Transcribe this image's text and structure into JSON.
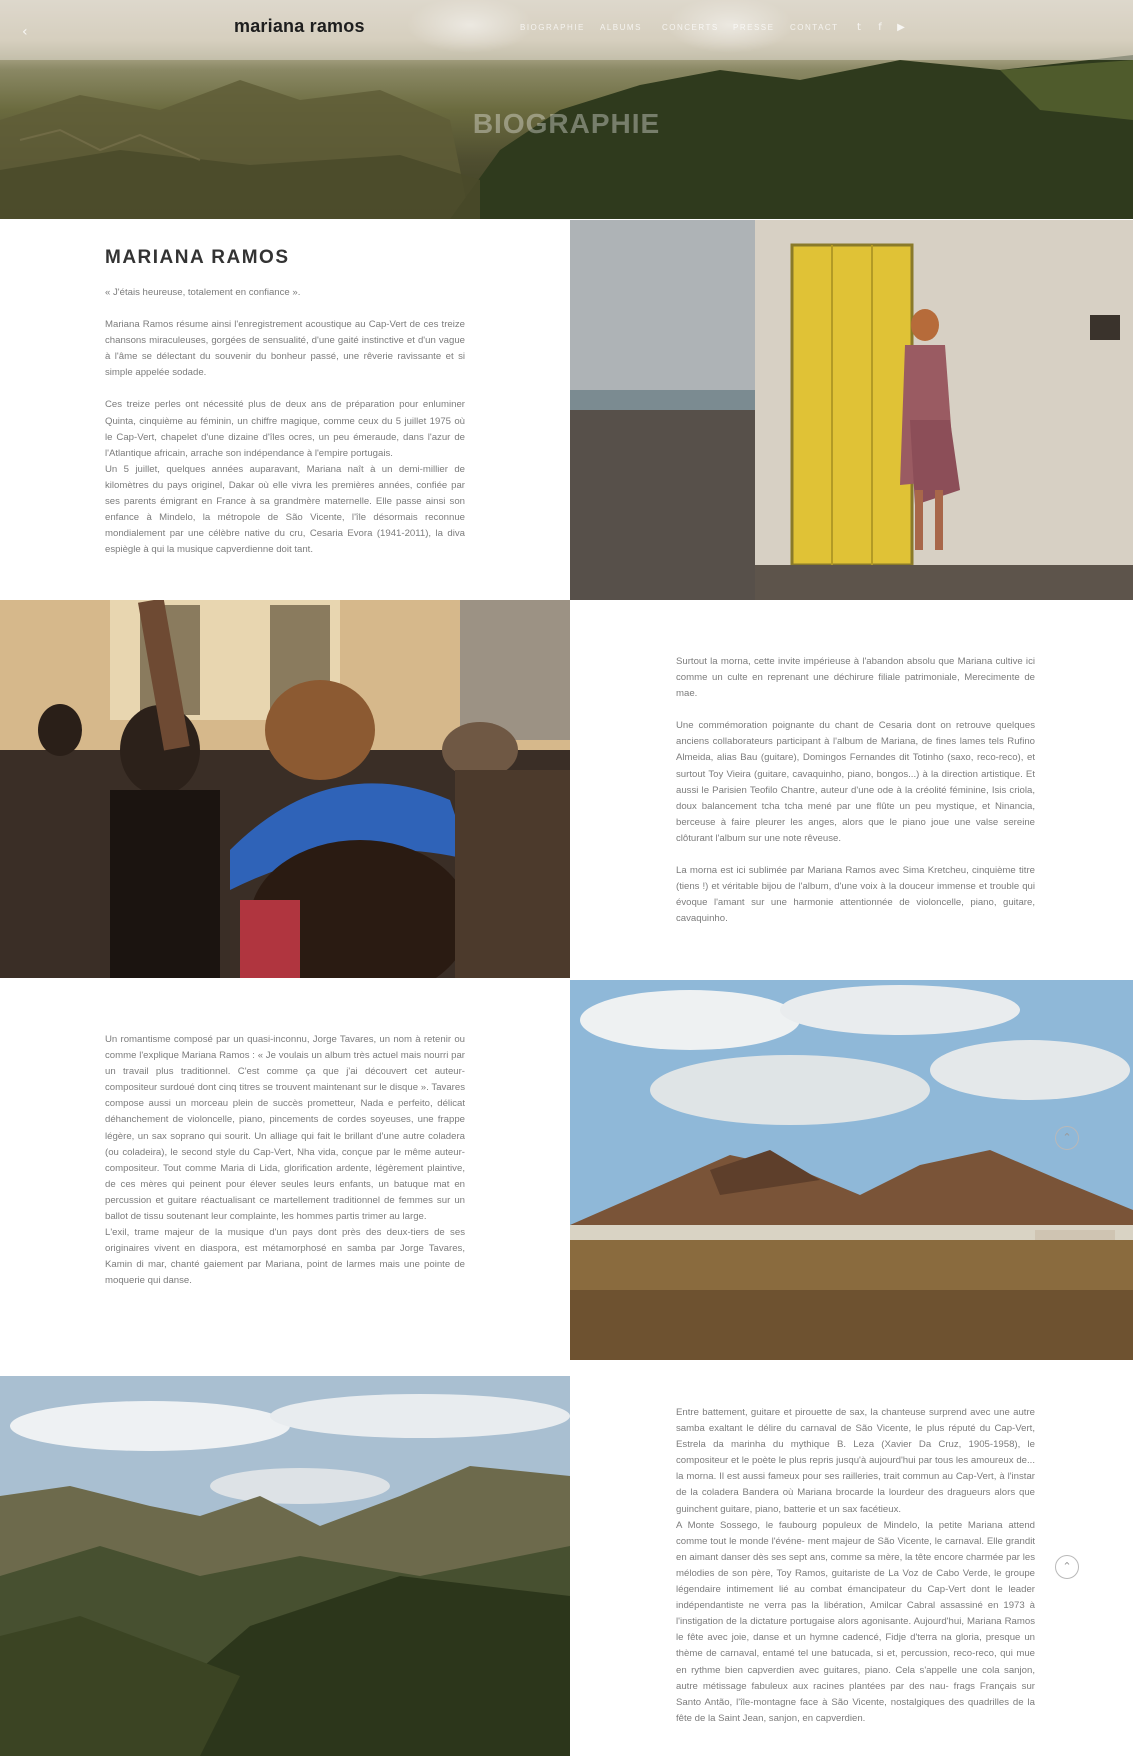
{
  "header": {
    "brand": "mariana ramos",
    "back_icon": "back-arrow-icon",
    "nav": [
      "BIOGRAPHIE",
      "ALBUMS",
      "CONCERTS",
      "PRESSE",
      "CONTACT"
    ],
    "social": [
      {
        "name": "twitter-icon",
        "glyph": "t"
      },
      {
        "name": "facebook-icon",
        "glyph": "f"
      },
      {
        "name": "youtube-icon",
        "glyph": "▶"
      }
    ]
  },
  "hero": {
    "title": "BIOGRAPHIE"
  },
  "section1": {
    "heading": "MARIANA RAMOS",
    "quote": "« J'étais heureuse, totalement en confiance ».",
    "p1": "Mariana Ramos résume ainsi l'enregistrement acoustique au Cap-Vert de ces treize chansons miraculeuses, gorgées de sensualité, d'une gaité instinctive et d'un vague à l'âme se délectant du souvenir du bonheur passé, une rêverie ravissante et si simple appelée sodade.",
    "p2": "Ces treize perles ont nécessité plus de deux ans de préparation pour enluminer Quinta, cinquième au féminin, un chiffre magique, comme ceux du 5 juillet 1975 où le Cap-Vert, chapelet d'une dizaine d'îles ocres, un peu émeraude, dans l'azur de l'Atlantique africain, arrache son indépendance à l'empire portugais.",
    "p3": "Un 5 juillet, quelques années auparavant, Mariana naît à un demi-millier de kilomètres du pays originel, Dakar où elle vivra les premières années, confiée par ses parents émigrant en France à sa grandmère maternelle. Elle passe ainsi son enfance à Mindelo, la métropole de São Vicente, l'île désormais reconnue mondialement par une célèbre native du cru, Cesaria Evora (1941-2011), la diva espiègle à qui la musique capverdienne doit tant."
  },
  "section2": {
    "p1": "Surtout la morna, cette invite impérieuse à l'abandon absolu que Mariana cultive ici comme un culte en reprenant une déchirure filiale patrimoniale, Merecimente de mae.",
    "p2": "Une commémoration poignante du chant de Cesaria dont on retrouve quelques anciens collaborateurs participant à l'album de Mariana, de fines lames tels Rufino Almeida, alias Bau (guitare), Domingos Fernandes dit Totinho (saxo, reco-reco), et surtout Toy Vieira (guitare, cavaquinho, piano, bongos...) à la direction artistique. Et aussi le Parisien Teofilo Chantre, auteur d'une ode à la créolité féminine, Isis criola, doux balancement tcha tcha mené par une flûte un peu mystique, et Ninancia, berceuse à faire pleurer les anges, alors que le piano joue une valse sereine clôturant l'album sur une note rêveuse.",
    "p3": "La morna est ici sublimée par Mariana Ramos avec Sima Kretcheu, cinquième titre (tiens !) et véritable bijou de l'album, d'une voix à la douceur immense et trouble qui évoque l'amant sur une harmonie attentionnée de violoncelle, piano, guitare, cavaquinho."
  },
  "section3": {
    "p1": "Un romantisme composé par un quasi-inconnu, Jorge Tavares, un nom à retenir ou comme l'explique Mariana Ramos : « Je voulais un album très actuel mais nourri par un travail plus traditionnel. C'est comme ça que j'ai découvert cet auteur-compositeur surdoué dont cinq titres se trouvent maintenant sur le disque ». Tavares compose aussi un morceau plein de succès prometteur, Nada e perfeito, délicat déhanchement de violoncelle, piano, pincements de cordes soyeuses, une frappe légère, un sax soprano qui sourit. Un alliage qui fait le brillant d'une autre coladera (ou coladeira), le second style du Cap-Vert, Nha vida, conçue par le même auteur-compositeur. Tout comme Maria di Lida, glorification ardente, légèrement plaintive, de ces mères qui peinent pour élever seules leurs enfants, un batuque mat en percussion et guitare réactualisant ce martellement traditionnel de femmes sur un ballot de tissu soutenant leur complainte, les hommes partis trimer au large.",
    "p2": "L'exil, trame majeur de la musique d'un pays dont près des deux-tiers de ses originaires vivent en diaspora, est métamorphosé en samba par Jorge Tavares, Kamin di mar, chanté gaiement par Mariana, point de larmes mais une pointe de moquerie qui danse."
  },
  "section4": {
    "p1": "Entre battement, guitare et pirouette de sax, la chanteuse surprend avec une autre samba exaltant le délire du carnaval de São Vicente, le plus réputé du Cap-Vert, Estrela da marinha du mythique B. Leza (Xavier Da Cruz, 1905-1958), le compositeur et le poète le plus repris jusqu'à aujourd'hui par tous les amoureux de... la morna. Il est aussi fameux pour ses railleries, trait commun au Cap-Vert, à l'instar de la coladera Bandera où Mariana brocarde la lourdeur des dragueurs alors que guinchent guitare, piano, batterie et un sax facétieux.",
    "p2": "A Monte Sossego, le faubourg populeux de Mindelo, la petite Mariana attend comme tout le monde l'événe- ment majeur de São Vicente, le carnaval. Elle grandit en aimant danser dès ses sept ans, comme sa mère, la tête encore charmée par les mélodies de son père, Toy Ramos, guitariste de La Voz de Cabo Verde, le groupe légendaire intimement lié au combat émancipateur du Cap-Vert dont le leader indépendantiste ne verra pas la libération, Amilcar Cabral assassiné en 1973 à l'instigation de la dictature portugaise alors agonisante. Aujourd'hui, Mariana Ramos le fête avec joie, danse et un hymne cadencé, Fidje d'terra na gloria, presque un thème de carnaval, entamé tel une batucada, si et, percussion, reco-reco, qui mue en rythme bien capverdien avec guitares, piano. Cela s'appelle une cola sanjon, autre métissage fabuleux aux racines plantées par des nau- frags Français sur Santo Antão, l'île-montagne face à São Vicente, nostalgiques des quadrilles de la fête de la Saint Jean, sanjon, en capverdien."
  },
  "controls": {
    "scroll_icon": "chevron-up-icon",
    "scroll_glyph": "⌃"
  },
  "colors": {
    "door_yellow": "#e0c236",
    "cap_blue": "#2f63b8",
    "sky_blue": "#8fb8d8"
  }
}
